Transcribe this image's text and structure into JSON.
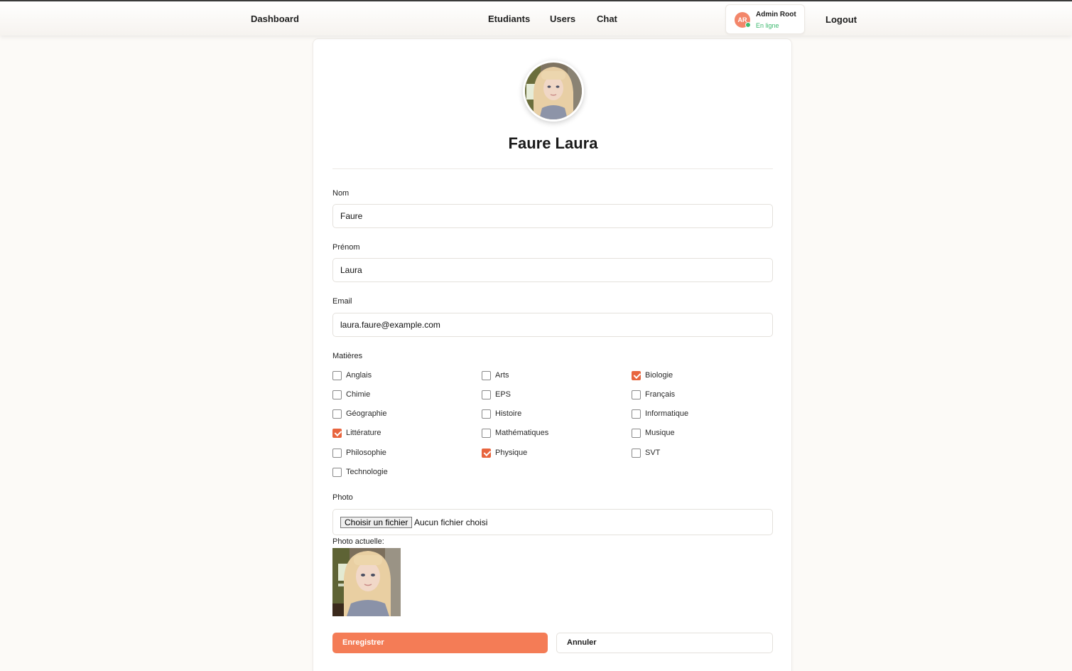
{
  "nav": {
    "dashboard": "Dashboard",
    "etudiants": "Etudiants",
    "users": "Users",
    "chat": "Chat",
    "logout": "Logout"
  },
  "user": {
    "initials": "AR",
    "name": "Admin Root",
    "status": "En ligne"
  },
  "profile": {
    "name": "Faure Laura"
  },
  "form": {
    "nom_label": "Nom",
    "nom_value": "Faure",
    "prenom_label": "Prénom",
    "prenom_value": "Laura",
    "email_label": "Email",
    "email_value": "laura.faure@example.com",
    "matieres_label": "Matières",
    "matieres": [
      {
        "label": "Anglais",
        "checked": false
      },
      {
        "label": "Arts",
        "checked": false
      },
      {
        "label": "Biologie",
        "checked": true
      },
      {
        "label": "Chimie",
        "checked": false
      },
      {
        "label": "EPS",
        "checked": false
      },
      {
        "label": "Français",
        "checked": false
      },
      {
        "label": "Géographie",
        "checked": false
      },
      {
        "label": "Histoire",
        "checked": false
      },
      {
        "label": "Informatique",
        "checked": false
      },
      {
        "label": "Littérature",
        "checked": true
      },
      {
        "label": "Mathématiques",
        "checked": false
      },
      {
        "label": "Musique",
        "checked": false
      },
      {
        "label": "Philosophie",
        "checked": false
      },
      {
        "label": "Physique",
        "checked": true
      },
      {
        "label": "SVT",
        "checked": false
      },
      {
        "label": "Technologie",
        "checked": false
      }
    ],
    "photo_label": "Photo",
    "file_button": "Choisir un fichier",
    "file_status": "Aucun fichier choisi",
    "current_photo_label": "Photo actuelle:",
    "save_label": "Enregistrer",
    "cancel_label": "Annuler"
  },
  "colors": {
    "accent": "#f47c56",
    "checkbox_checked": "#e8653e",
    "online": "#3dba6f"
  }
}
